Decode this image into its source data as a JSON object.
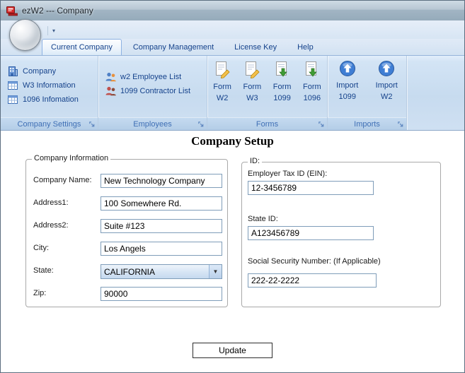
{
  "window": {
    "title": "ezW2 --- Company"
  },
  "icons": {
    "qa_dropdown": "▾",
    "combo_arrow": "▼"
  },
  "ribbon": {
    "tabs": [
      {
        "label": "Current Company"
      },
      {
        "label": "Company Management"
      },
      {
        "label": "License Key"
      },
      {
        "label": "Help"
      }
    ],
    "groups": {
      "company_settings": {
        "label": "Company Settings",
        "items": [
          {
            "label": "Company"
          },
          {
            "label": "W3 Information"
          },
          {
            "label": "1096 Infomation"
          }
        ]
      },
      "employees": {
        "label": "Employees",
        "items": [
          {
            "label": "w2 Employee List"
          },
          {
            "label": "1099 Contractor List"
          }
        ]
      },
      "forms": {
        "label": "Forms",
        "items": [
          {
            "top": "Form",
            "bottom": "W2"
          },
          {
            "top": "Form",
            "bottom": "W3"
          },
          {
            "top": "Form",
            "bottom": "1099"
          },
          {
            "top": "Form",
            "bottom": "1096"
          }
        ]
      },
      "imports": {
        "label": "Imports",
        "items": [
          {
            "top": "Import",
            "bottom": "1099"
          },
          {
            "top": "Import",
            "bottom": "W2"
          }
        ]
      }
    }
  },
  "main": {
    "title": "Company Setup",
    "company_info": {
      "legend": "Company Information",
      "fields": [
        {
          "label": "Company Name:",
          "value": "New Technology Company"
        },
        {
          "label": "Address1:",
          "value": "100 Somewhere Rd."
        },
        {
          "label": "Address2:",
          "value": "Suite #123"
        },
        {
          "label": "City:",
          "value": "Los Angels"
        },
        {
          "label": "State:",
          "value": "CALIFORNIA"
        },
        {
          "label": "Zip:",
          "value": "90000"
        }
      ]
    },
    "ids": {
      "legend": "ID:",
      "fields": [
        {
          "label": "Employer Tax ID (EIN):",
          "value": "12-3456789"
        },
        {
          "label": "State ID:",
          "value": "A123456789"
        },
        {
          "label": "Social Security Number: (If Applicable)",
          "value": "222-22-2222"
        }
      ]
    },
    "update_button": "Update"
  },
  "colors": {
    "ribbon_text": "#15428b",
    "caption_text": "#3f6fb5",
    "input_border": "#7f9db9"
  }
}
